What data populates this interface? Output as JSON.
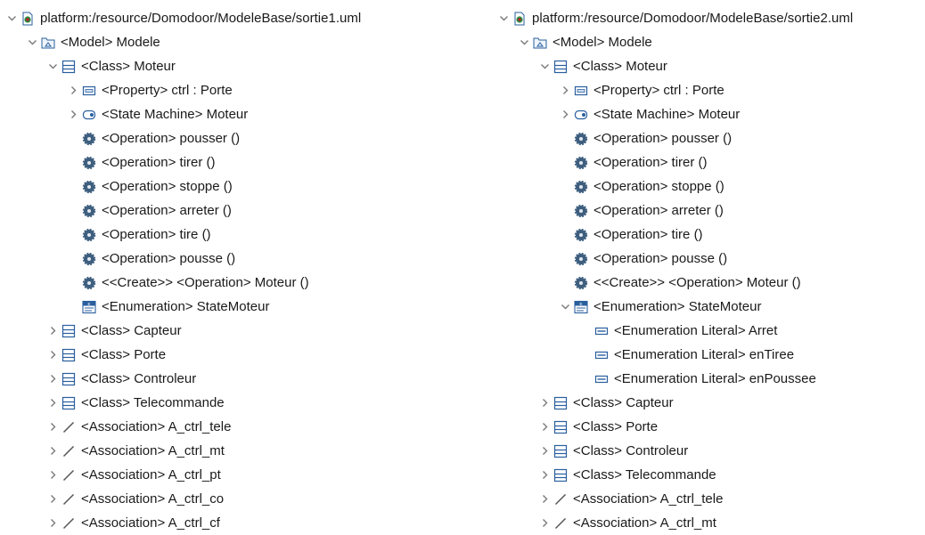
{
  "left_tree": {
    "root": "platform:/resource/Domodoor/ModeleBase/sortie1.uml",
    "items": [
      {
        "level": 0,
        "exp": "open",
        "icon": "resource-icon",
        "label": "platform:/resource/Domodoor/ModeleBase/sortie1.uml"
      },
      {
        "level": 1,
        "exp": "open",
        "icon": "model-icon",
        "label": "<Model> Modele"
      },
      {
        "level": 2,
        "exp": "open",
        "icon": "class-icon",
        "label": "<Class> Moteur"
      },
      {
        "level": 3,
        "exp": "closed",
        "icon": "property-icon",
        "label": "<Property> ctrl : Porte"
      },
      {
        "level": 3,
        "exp": "closed",
        "icon": "state-machine-icon",
        "label": "<State Machine> Moteur"
      },
      {
        "level": 3,
        "exp": "none",
        "icon": "operation-icon",
        "label": "<Operation> pousser ()"
      },
      {
        "level": 3,
        "exp": "none",
        "icon": "operation-icon",
        "label": "<Operation> tirer ()"
      },
      {
        "level": 3,
        "exp": "none",
        "icon": "operation-icon",
        "label": "<Operation> stoppe ()"
      },
      {
        "level": 3,
        "exp": "none",
        "icon": "operation-icon",
        "label": "<Operation> arreter ()"
      },
      {
        "level": 3,
        "exp": "none",
        "icon": "operation-icon",
        "label": "<Operation> tire ()"
      },
      {
        "level": 3,
        "exp": "none",
        "icon": "operation-icon",
        "label": "<Operation> pousse ()"
      },
      {
        "level": 3,
        "exp": "none",
        "icon": "operation-icon",
        "label": "<<Create>> <Operation> Moteur ()"
      },
      {
        "level": 3,
        "exp": "none",
        "icon": "enumeration-icon",
        "label": "<Enumeration> StateMoteur"
      },
      {
        "level": 2,
        "exp": "closed",
        "icon": "class-icon",
        "label": "<Class> Capteur"
      },
      {
        "level": 2,
        "exp": "closed",
        "icon": "class-icon",
        "label": "<Class> Porte"
      },
      {
        "level": 2,
        "exp": "closed",
        "icon": "class-icon",
        "label": "<Class> Controleur"
      },
      {
        "level": 2,
        "exp": "closed",
        "icon": "class-icon",
        "label": "<Class> Telecommande"
      },
      {
        "level": 2,
        "exp": "closed",
        "icon": "association-icon",
        "label": "<Association> A_ctrl_tele"
      },
      {
        "level": 2,
        "exp": "closed",
        "icon": "association-icon",
        "label": "<Association> A_ctrl_mt"
      },
      {
        "level": 2,
        "exp": "closed",
        "icon": "association-icon",
        "label": "<Association> A_ctrl_pt"
      },
      {
        "level": 2,
        "exp": "closed",
        "icon": "association-icon",
        "label": "<Association> A_ctrl_co"
      },
      {
        "level": 2,
        "exp": "closed",
        "icon": "association-icon",
        "label": "<Association> A_ctrl_cf"
      }
    ]
  },
  "right_tree": {
    "root": "platform:/resource/Domodoor/ModeleBase/sortie2.uml",
    "items": [
      {
        "level": 0,
        "exp": "open",
        "icon": "resource-icon",
        "label": "platform:/resource/Domodoor/ModeleBase/sortie2.uml"
      },
      {
        "level": 1,
        "exp": "open",
        "icon": "model-icon",
        "label": "<Model> Modele"
      },
      {
        "level": 2,
        "exp": "open",
        "icon": "class-icon",
        "label": "<Class> Moteur"
      },
      {
        "level": 3,
        "exp": "closed",
        "icon": "property-icon",
        "label": "<Property> ctrl : Porte"
      },
      {
        "level": 3,
        "exp": "closed",
        "icon": "state-machine-icon",
        "label": "<State Machine> Moteur"
      },
      {
        "level": 3,
        "exp": "none",
        "icon": "operation-icon",
        "label": "<Operation> pousser ()"
      },
      {
        "level": 3,
        "exp": "none",
        "icon": "operation-icon",
        "label": "<Operation> tirer ()"
      },
      {
        "level": 3,
        "exp": "none",
        "icon": "operation-icon",
        "label": "<Operation> stoppe ()"
      },
      {
        "level": 3,
        "exp": "none",
        "icon": "operation-icon",
        "label": "<Operation> arreter ()"
      },
      {
        "level": 3,
        "exp": "none",
        "icon": "operation-icon",
        "label": "<Operation> tire ()"
      },
      {
        "level": 3,
        "exp": "none",
        "icon": "operation-icon",
        "label": "<Operation> pousse ()"
      },
      {
        "level": 3,
        "exp": "none",
        "icon": "operation-icon",
        "label": "<<Create>> <Operation> Moteur ()"
      },
      {
        "level": 3,
        "exp": "open",
        "icon": "enumeration-icon",
        "label": "<Enumeration> StateMoteur"
      },
      {
        "level": 4,
        "exp": "none",
        "icon": "enum-literal-icon",
        "label": "<Enumeration Literal> Arret"
      },
      {
        "level": 4,
        "exp": "none",
        "icon": "enum-literal-icon",
        "label": "<Enumeration Literal> enTiree"
      },
      {
        "level": 4,
        "exp": "none",
        "icon": "enum-literal-icon",
        "label": "<Enumeration Literal> enPoussee"
      },
      {
        "level": 2,
        "exp": "closed",
        "icon": "class-icon",
        "label": "<Class> Capteur"
      },
      {
        "level": 2,
        "exp": "closed",
        "icon": "class-icon",
        "label": "<Class> Porte"
      },
      {
        "level": 2,
        "exp": "closed",
        "icon": "class-icon",
        "label": "<Class> Controleur"
      },
      {
        "level": 2,
        "exp": "closed",
        "icon": "class-icon",
        "label": "<Class> Telecommande"
      },
      {
        "level": 2,
        "exp": "closed",
        "icon": "association-icon",
        "label": "<Association> A_ctrl_tele"
      },
      {
        "level": 2,
        "exp": "closed",
        "icon": "association-icon",
        "label": "<Association> A_ctrl_mt"
      }
    ]
  },
  "colors": {
    "chevron": "#7a7a7a",
    "text": "#1a1a1a",
    "icon_blue": "#2a5f9e",
    "icon_light": "#cfe0f3",
    "gear": "#3f5f7f",
    "association": "#555555"
  }
}
